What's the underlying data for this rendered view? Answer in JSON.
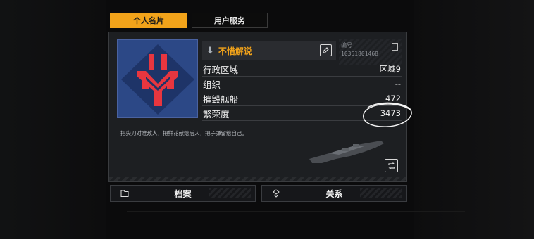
{
  "tabs": [
    {
      "label": "个人名片",
      "active": true
    },
    {
      "label": "用户服务",
      "active": false
    }
  ],
  "card": {
    "name": "不惜解说",
    "id_label": "编号",
    "id_value": "1035180146​8",
    "fields": [
      {
        "key": "行政区域",
        "value": "区域9"
      },
      {
        "key": "组织",
        "value": "--"
      },
      {
        "key": "摧毁舰船",
        "value": "472"
      },
      {
        "key": "繁荣度",
        "value": "3473"
      }
    ],
    "motto": "把尖刀对准敌人，把鲜花献给后人，把子弹留给自己。"
  },
  "buttons": {
    "archive": "档案",
    "relation": "关系"
  },
  "colors": {
    "accent": "#f2a31a",
    "emblem_bg": "#2c4886",
    "emblem_mark": "#e8363f"
  },
  "icons": [
    "down-arrow-icon",
    "edit-icon",
    "copy-icon",
    "swap-icon",
    "folder-icon",
    "relation-icon",
    "emblem-logo",
    "ship-image"
  ]
}
